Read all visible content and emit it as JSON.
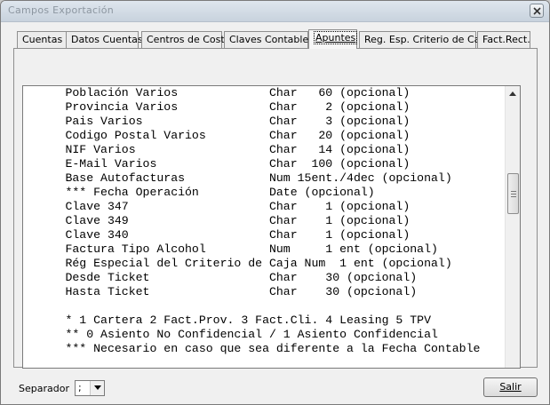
{
  "window": {
    "title": "Campos Exportación"
  },
  "tabs": [
    {
      "label": "Cuentas",
      "active": false
    },
    {
      "label": "Datos Cuentas",
      "active": false
    },
    {
      "label": "Centros de Coste",
      "active": false
    },
    {
      "label": "Claves Contables",
      "active": false
    },
    {
      "label": "Apuntes",
      "active": true
    },
    {
      "label": "Reg. Esp. Criterio de Caja",
      "active": false
    },
    {
      "label": "Fact.Rect.",
      "active": false
    }
  ],
  "content": {
    "lines": [
      "      Población Varios             Char   60 (opcional)",
      "      Provincia Varios             Char    2 (opcional)",
      "      Pais Varios                  Char    3 (opcional)",
      "      Codigo Postal Varios         Char   20 (opcional)",
      "      NIF Varios                   Char   14 (opcional)",
      "      E-Mail Varios                Char  100 (opcional)",
      "      Base Autofacturas            Num 15ent./4dec (opcional)",
      "      *** Fecha Operación          Date (opcional)",
      "      Clave 347                    Char    1 (opcional)",
      "      Clave 349                    Char    1 (opcional)",
      "      Clave 340                    Char    1 (opcional)",
      "      Factura Tipo Alcohol         Num     1 ent (opcional)",
      "      Rég Especial del Criterio de Caja Num  1 ent (opcional)",
      "      Desde Ticket                 Char    30 (opcional)",
      "      Hasta Ticket                 Char    30 (opcional)",
      "",
      "      * 1 Cartera 2 Fact.Prov. 3 Fact.Cli. 4 Leasing 5 TPV",
      "      ** 0 Asiento No Confidencial / 1 Asiento Confidencial",
      "      *** Necesario en caso que sea diferente a la Fecha Contable"
    ]
  },
  "footer": {
    "separator_label": "Separador",
    "separator_value": ";",
    "exit_label": "Salir"
  },
  "icons": {
    "close": "close-icon",
    "scroll_up": "arrow-up-icon",
    "dropdown": "chevron-down-icon"
  }
}
